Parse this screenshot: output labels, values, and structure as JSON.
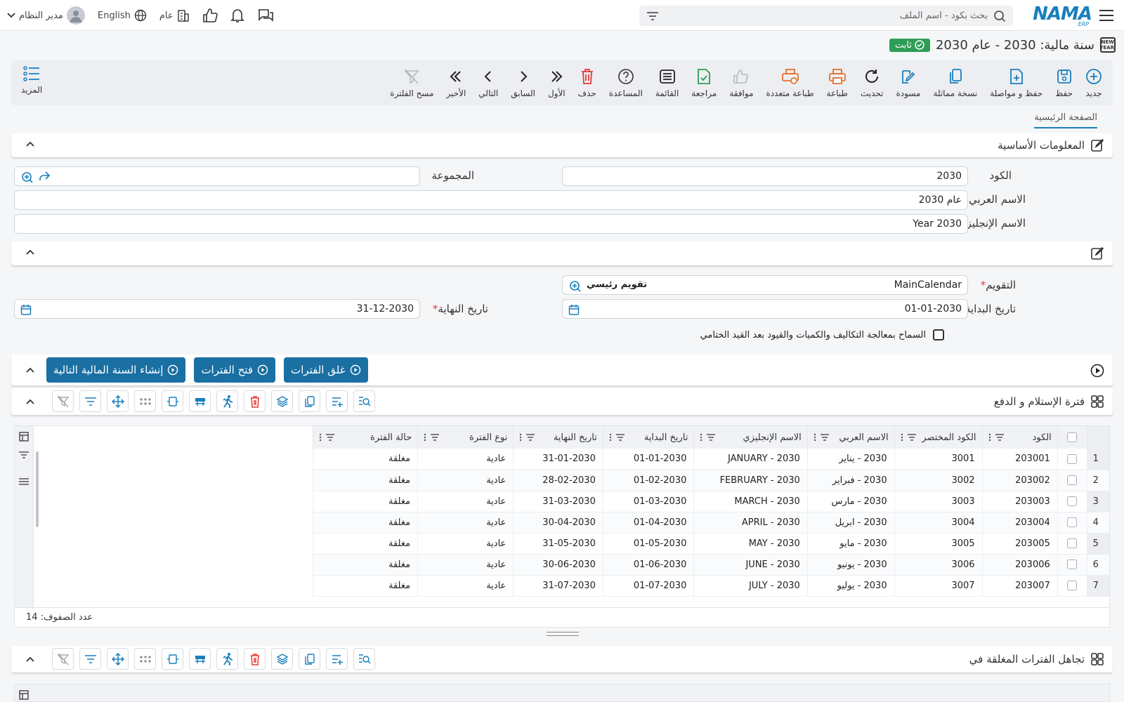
{
  "topbar": {
    "logo": "NAMA",
    "logo_sub": "ERP",
    "search_placeholder": "بحث بكود - اسم الملف",
    "user_name": "مدير النظام",
    "language": "English",
    "scope": "عام",
    "icons": [
      "menu-icon",
      "filter-icon",
      "search-icon",
      "building-icon",
      "thumbs-up-icon",
      "bell-icon",
      "chat-icon",
      "globe-icon",
      "user-icon",
      "chevron-down-icon"
    ]
  },
  "title": {
    "text": "سنة مالية: 2030 - عام 2030",
    "badge": "ثابت",
    "new_year_icon_top": "NEW",
    "new_year_icon_bottom": "YEAR"
  },
  "toolbar": {
    "items": [
      {
        "label": "جديد",
        "icon": "plus-circle-icon"
      },
      {
        "label": "حفظ",
        "icon": "save-icon"
      },
      {
        "label": "حفظ و مواصلة",
        "icon": "file-plus-icon"
      },
      {
        "label": "نسخة مماثلة",
        "icon": "copy-icon"
      },
      {
        "label": "مسودة",
        "icon": "edit-icon"
      },
      {
        "label": "تحديث",
        "icon": "refresh-icon"
      },
      {
        "label": "طباعة",
        "icon": "printer-icon"
      },
      {
        "label": "طباعة متعددة",
        "icon": "multi-print-icon"
      },
      {
        "label": "موافقة",
        "icon": "thumbs-up-icon"
      },
      {
        "label": "مراجعة",
        "icon": "file-check-icon"
      },
      {
        "label": "القائمة",
        "icon": "list-icon"
      },
      {
        "label": "المساعدة",
        "icon": "help-icon"
      },
      {
        "label": "حذف",
        "icon": "trash-icon"
      },
      {
        "label": "الأول",
        "icon": "first-icon"
      },
      {
        "label": "السابق",
        "icon": "prev-icon"
      },
      {
        "label": "التالي",
        "icon": "next-icon"
      },
      {
        "label": "الأخير",
        "icon": "last-icon"
      },
      {
        "label": "مسح الفلترة",
        "icon": "clear-filter-icon"
      }
    ],
    "more_label": "المزيد"
  },
  "tabs": {
    "main": "الصفحة الرئيسية"
  },
  "basic_info": {
    "title": "المعلومات الأساسية",
    "code_label": "الكود",
    "code_value": "2030",
    "group_label": "المجموعة",
    "group_value": "",
    "arabic_name_label": "الاسم العربي",
    "arabic_name_value": "عام 2030",
    "english_name_label": "الاسم الإنجليزي",
    "english_name_value": "Year 2030"
  },
  "calendar": {
    "calendar_label": "التقويم",
    "calendar_value": "MainCalendar",
    "calendar_name": "تقويم رئيسي",
    "start_label": "تاريخ البداية",
    "start_value": "01-01-2030",
    "end_label": "تاريخ النهاية",
    "end_value": "31-12-2030",
    "allow_label": "السماح بمعالجة التكاليف والكميات والقيود بعد القيد الختامي"
  },
  "actions": {
    "close_periods": "غلق الفترات",
    "open_periods": "فتح الفترات",
    "create_next": "إنشاء السنة المالية التالية"
  },
  "periods": {
    "title": "فترة الإستلام و الدفع",
    "columns": [
      "الكود",
      "الكود المختصر",
      "الاسم العربي",
      "الاسم الإنجليزي",
      "تاريخ البداية",
      "تاريخ النهاية",
      "نوع الفترة",
      "حالة الفترة"
    ],
    "rows": [
      {
        "n": "1",
        "code": "203001",
        "short": "3001",
        "ar": "2030 - يناير",
        "en": "JANUARY - 2030",
        "start": "01-01-2030",
        "end": "31-01-2030",
        "type": "عادية",
        "status": "مغلقة"
      },
      {
        "n": "2",
        "code": "203002",
        "short": "3002",
        "ar": "2030 - فبراير",
        "en": "FEBRUARY - 2030",
        "start": "01-02-2030",
        "end": "28-02-2030",
        "type": "عادية",
        "status": "مغلقة"
      },
      {
        "n": "3",
        "code": "203003",
        "short": "3003",
        "ar": "2030 - مارس",
        "en": "MARCH - 2030",
        "start": "01-03-2030",
        "end": "31-03-2030",
        "type": "عادية",
        "status": "مغلقة"
      },
      {
        "n": "4",
        "code": "203004",
        "short": "3004",
        "ar": "2030 - ابريل",
        "en": "APRIL - 2030",
        "start": "01-04-2030",
        "end": "30-04-2030",
        "type": "عادية",
        "status": "مغلقة"
      },
      {
        "n": "5",
        "code": "203005",
        "short": "3005",
        "ar": "2030 - مايو",
        "en": "MAY - 2030",
        "start": "01-05-2030",
        "end": "31-05-2030",
        "type": "عادية",
        "status": "مغلقة"
      },
      {
        "n": "6",
        "code": "203006",
        "short": "3006",
        "ar": "2030 - يونيو",
        "en": "JUNE - 2030",
        "start": "01-06-2030",
        "end": "30-06-2030",
        "type": "عادية",
        "status": "مغلقة"
      },
      {
        "n": "7",
        "code": "203007",
        "short": "3007",
        "ar": "2030 - يوليو",
        "en": "JULY - 2030",
        "start": "01-07-2030",
        "end": "31-07-2030",
        "type": "عادية",
        "status": "مغلقة"
      }
    ],
    "row_count_label": "عدد الصفوف:",
    "row_count": "14"
  },
  "ignored": {
    "title": "تجاهل الفترات المغلقة في"
  },
  "colors": {
    "accent": "#1a6fa3",
    "badge": "#2e9d57",
    "print": "#e8702a",
    "delete": "#e53935"
  }
}
